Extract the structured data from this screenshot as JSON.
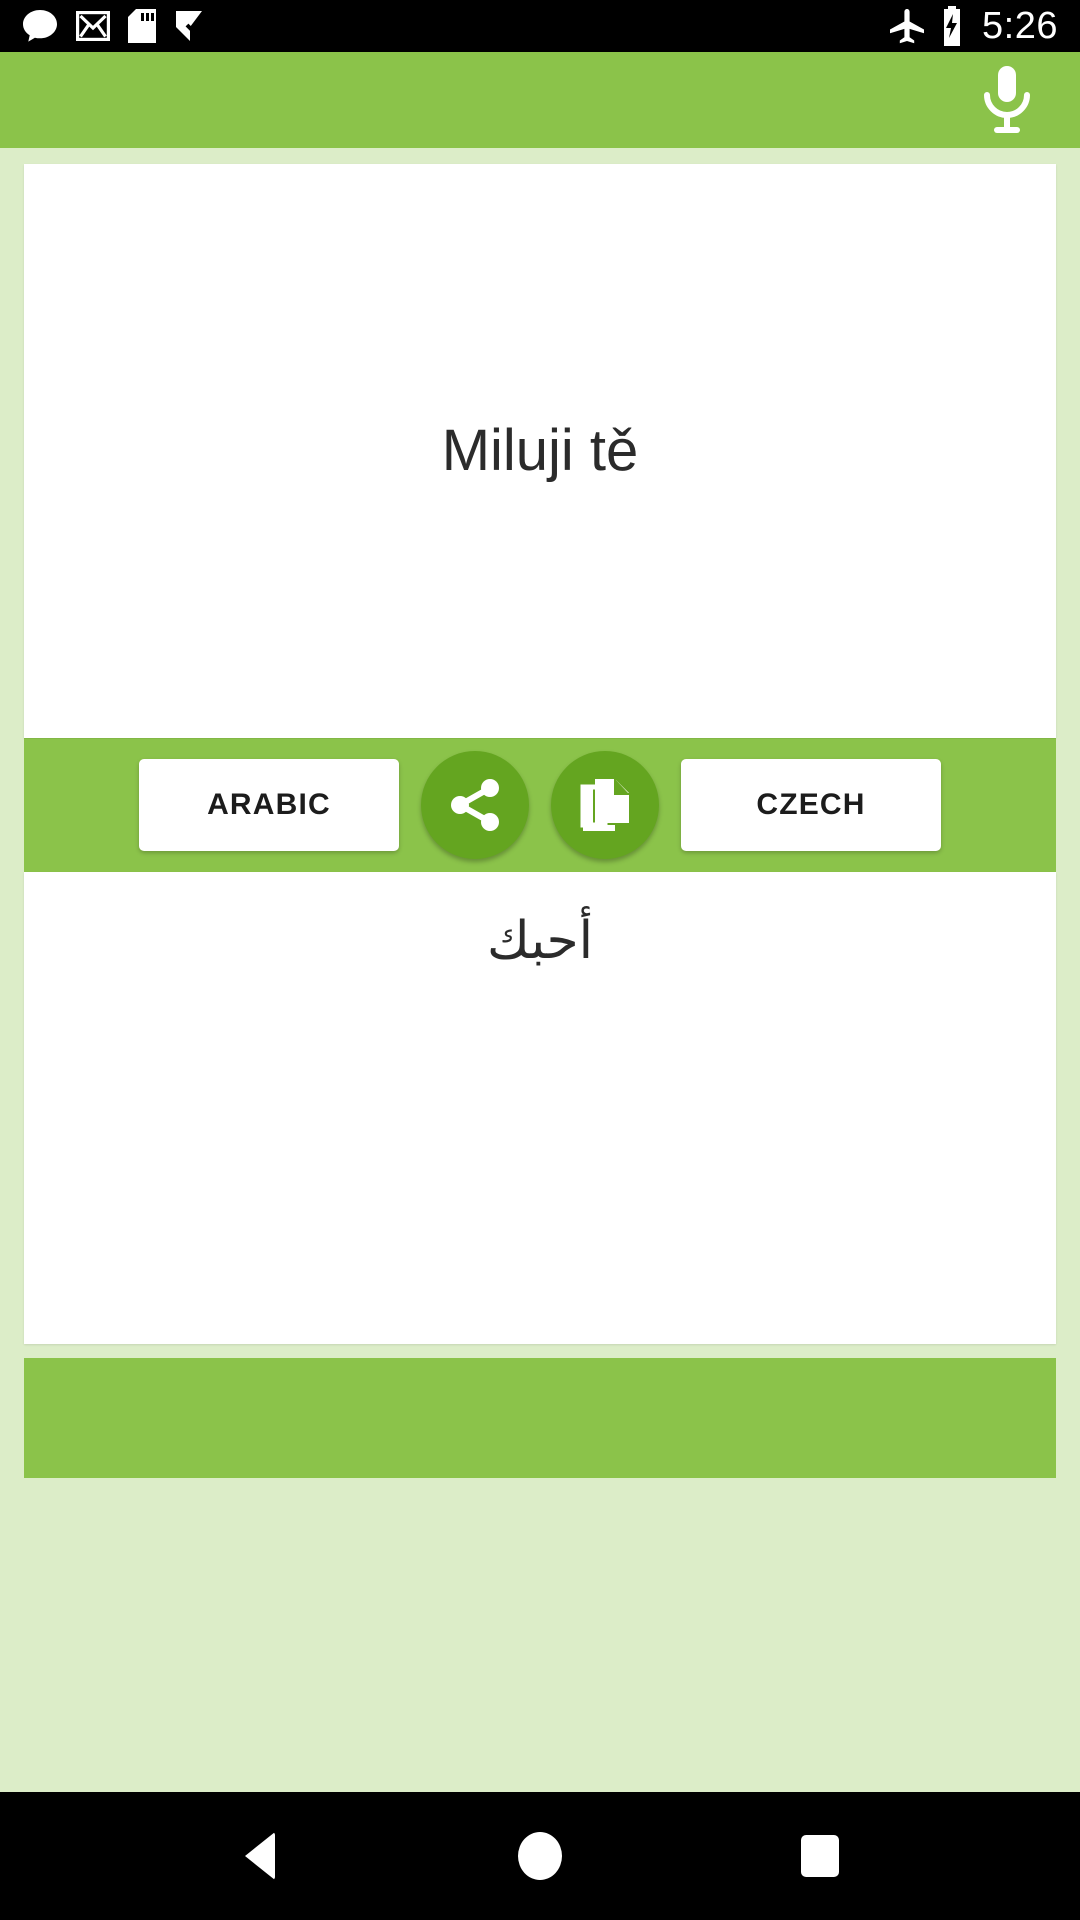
{
  "status_bar": {
    "icons": [
      "chat-bubble-icon",
      "gmail-icon",
      "sd-card-icon",
      "check-flag-icon"
    ],
    "airplane_icon": "airplane-mode-icon",
    "battery_icon": "battery-charging-icon",
    "time": "5:26"
  },
  "app_bar": {
    "mic_icon": "microphone-icon"
  },
  "translation": {
    "source_text": "Miluji tě",
    "target_text": "أحبك"
  },
  "actions": {
    "left_language": "ARABIC",
    "share_icon": "share-icon",
    "copy_icon": "copy-icon",
    "right_language": "CZECH"
  },
  "navigation": {
    "back": "back-button",
    "home": "home-button",
    "recents": "recents-button"
  },
  "colors": {
    "accent_green": "#8BC34A",
    "dark_green": "#64A520",
    "page_background": "#DCEDC8",
    "card_white": "#FFFFFF",
    "status_black": "#000000"
  }
}
